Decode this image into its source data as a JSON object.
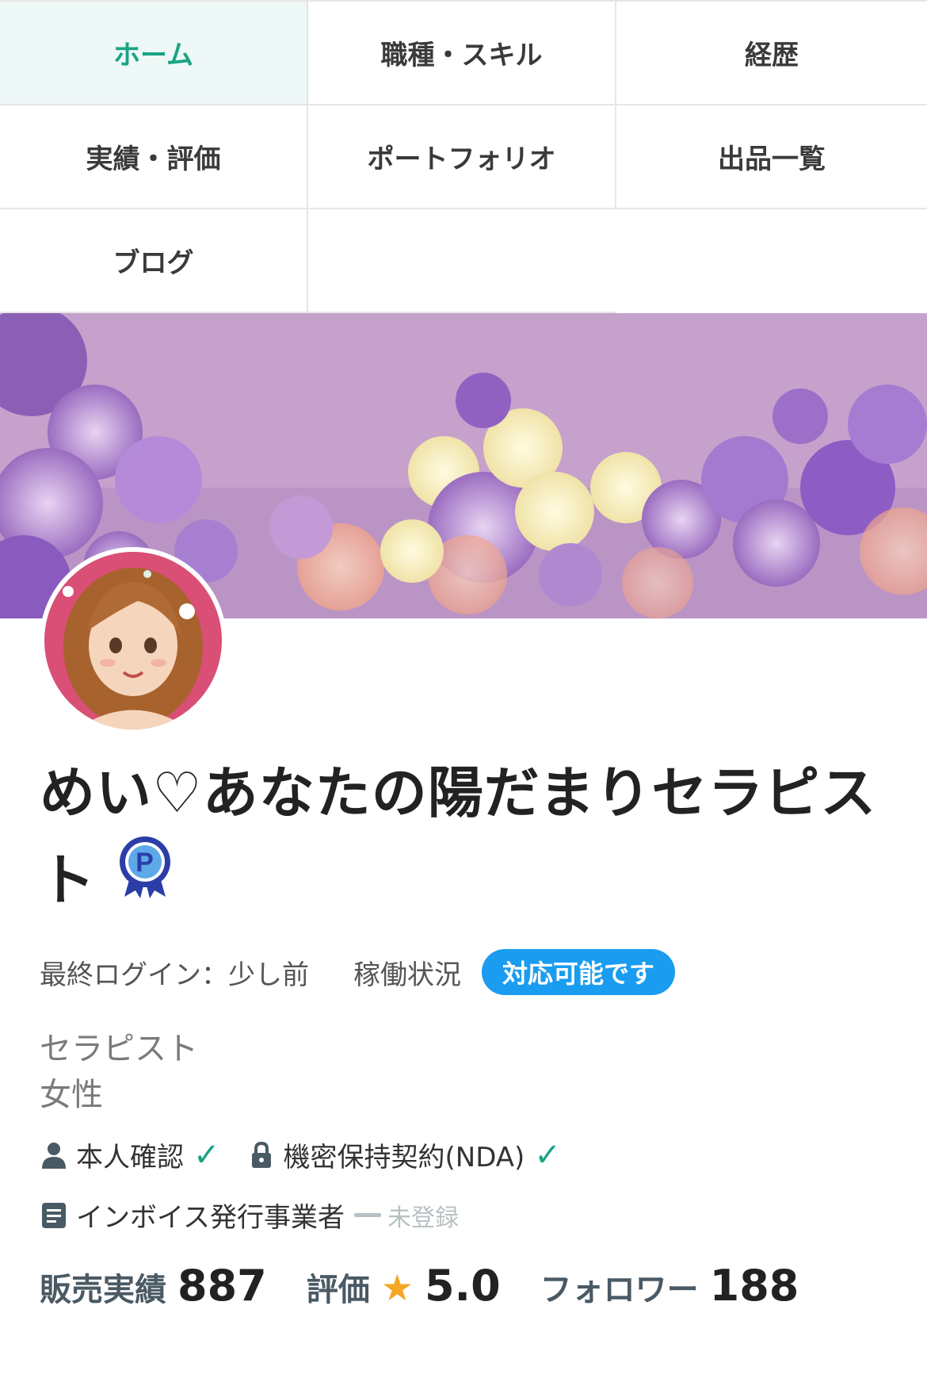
{
  "nav": {
    "items": [
      {
        "label": "ホーム",
        "active": true
      },
      {
        "label": "職種・スキル",
        "active": false
      },
      {
        "label": "経歴",
        "active": false
      },
      {
        "label": "実績・評価",
        "active": false
      },
      {
        "label": "ポートフォリオ",
        "active": false
      },
      {
        "label": "出品一覧",
        "active": false
      },
      {
        "label": "ブログ",
        "active": false
      }
    ]
  },
  "profile": {
    "name": "めい♡あなたの陽だまりセラピスト",
    "badge_icon": "pro-badge-icon",
    "last_login_label": "最終ログイン：少し前",
    "work_status_label": "稼働状況",
    "availability": "対応可能です",
    "occupation": "セラピスト",
    "gender": "女性"
  },
  "verification": {
    "identity_label": "本人確認",
    "nda_label": "機密保持契約(NDA)",
    "check_mark": "✓",
    "invoice_label": "インボイス発行事業者",
    "invoice_status": "未登録"
  },
  "stats": {
    "sales_label": "販売実績",
    "sales_value": "887",
    "rating_label": "評価",
    "rating_star": "★",
    "rating_value": "5.0",
    "followers_label": "フォロワー",
    "followers_value": "188"
  },
  "colors": {
    "accent_green": "#1aa385",
    "available_blue": "#1a9cf0",
    "star_orange": "#f5a623"
  }
}
